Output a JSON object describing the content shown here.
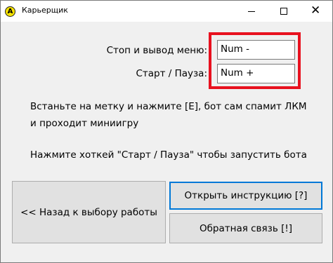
{
  "window": {
    "title": "Карьерщик",
    "close_glyph": "✕"
  },
  "hotkeys": [
    {
      "label": "Стоп и вывод меню:",
      "value": "Num -"
    },
    {
      "label": "Старт / Пауза:",
      "value": "Num +"
    }
  ],
  "info": {
    "line1": "Встаньте на метку и нажмите [E], бот сам спамит ЛКМ",
    "line2": "и проходит миниигру",
    "line3": "Нажмите хоткей \"Старт / Пауза\" чтобы запустить бота"
  },
  "buttons": {
    "back": "<< Назад к выбору работы",
    "instructions": "Открыть инструкцию [?]",
    "feedback": "Обратная связь [!]"
  },
  "colors": {
    "highlight": "#e8111f",
    "focus": "#0078d7",
    "app_icon": "#f6e200"
  },
  "icons": {
    "app": "yellow-circle-A-icon"
  }
}
